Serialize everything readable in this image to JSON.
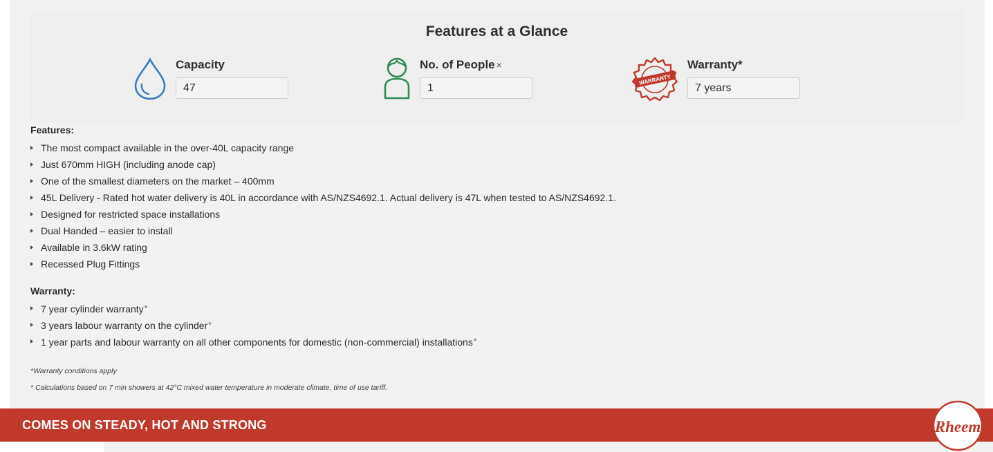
{
  "glance": {
    "title": "Features at a Glance",
    "capacity": {
      "label": "Capacity",
      "value": "47"
    },
    "people": {
      "label": "No. of People",
      "mark": "×",
      "value": "1"
    },
    "warranty": {
      "label": "Warranty*",
      "value": "7 years",
      "stamp_text": "WARRANTY"
    }
  },
  "features": {
    "title": "Features:",
    "items": [
      "The most compact available in the over-40L capacity range",
      "Just 670mm HIGH (including anode cap)",
      "One of the smallest diameters on the market – 400mm",
      "45L Delivery - Rated hot water delivery is 40L in accordance with AS/NZS4692.1. Actual delivery is 47L when tested to AS/NZS4692.1.",
      "Designed for restricted space installations",
      "Dual Handed – easier to install",
      "Available in 3.6kW rating",
      "Recessed Plug Fittings"
    ]
  },
  "warranty_section": {
    "title": "Warranty:",
    "items": [
      {
        "text": "7 year cylinder warranty",
        "star": "*"
      },
      {
        "text": "3 years labour warranty on the cylinder",
        "star": "*"
      },
      {
        "text": "1 year parts and labour warranty on all other components for domestic (non-commercial) installations",
        "star": "*"
      }
    ]
  },
  "notes": {
    "warranty_conditions": "*Warranty conditions apply",
    "calculations": "* Calculations based on 7 min showers at 42°C mixed water temperature in moderate climate, time of use tariff."
  },
  "banner": {
    "text": "COMES ON STEADY, HOT AND STRONG"
  },
  "logo": {
    "text": "Rheem"
  },
  "colors": {
    "water_icon": "#3a7bbf",
    "person_icon": "#2e8b57",
    "warranty_icon": "#c0392b",
    "banner": "#c0392b",
    "panel": "#f2f2f2"
  },
  "icons": [
    "water-drop-icon",
    "person-icon",
    "warranty-stamp-icon",
    "rheem-logo"
  ]
}
